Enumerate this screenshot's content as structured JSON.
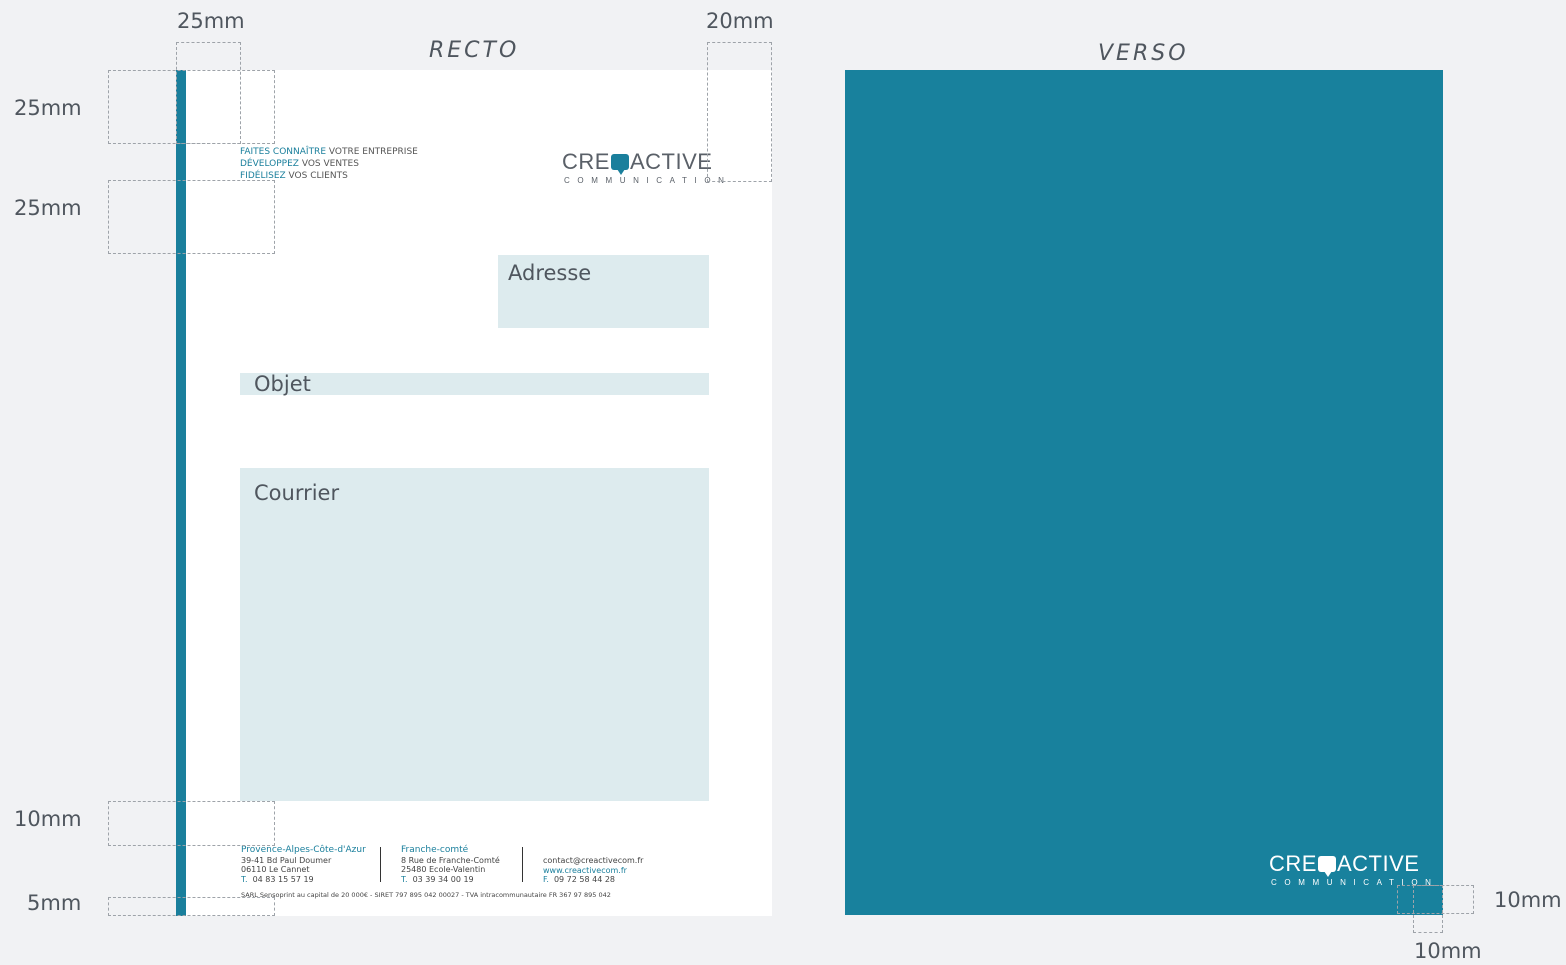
{
  "titles": {
    "recto": "RECTO",
    "verso": "VERSO"
  },
  "dimensions": {
    "recto_top_left": "25mm",
    "recto_top_right": "20mm",
    "left_top_1": "25mm",
    "left_top_2": "25mm",
    "left_bottom_1": "10mm",
    "left_bottom_2": "5mm",
    "verso_right": "10mm",
    "verso_bottom": "10mm"
  },
  "tagline": [
    {
      "accent": "FAITES CONNAÎTRE",
      "rest": " VOTRE ENTREPRISE"
    },
    {
      "accent": "DÉVELOPPEZ",
      "rest": " VOS VENTES"
    },
    {
      "accent": "FIDÉLISEZ",
      "rest": " VOS CLIENTS"
    }
  ],
  "logo": {
    "left": "CRE",
    "right": "ACTIVE",
    "sub": "COMMUNICATION"
  },
  "boxes": {
    "adresse": "Adresse",
    "objet": "Objet",
    "courrier": "Courrier"
  },
  "footer": {
    "col1": {
      "title": "Provence-Alpes-Côte-d'Azur",
      "line1": "39-41 Bd Paul Doumer",
      "line2": "06110 Le Cannet",
      "tel_label": "T.",
      "tel": "04 83 15 57 19"
    },
    "col2": {
      "title": "Franche-comté",
      "line1": "8 Rue de Franche-Comté",
      "line2": "25480 Ecole-Valentin",
      "tel_label": "T.",
      "tel": "03 39 34 00 19"
    },
    "col3": {
      "email": "contact@creactivecom.fr",
      "web": "www.creactivecom.fr",
      "fax_label": "F.",
      "fax": "09 72 58 44 28"
    },
    "legal": "SARL Sensoprint au capital de 20 000€ - SIRET 797 895 042 00027 - TVA intracommunautaire FR 367 97 895 042"
  },
  "colors": {
    "brand": "#1a7f9c",
    "verso_bg": "#18819d",
    "box_bg": "#ddebee",
    "background": "#f1f2f4"
  }
}
